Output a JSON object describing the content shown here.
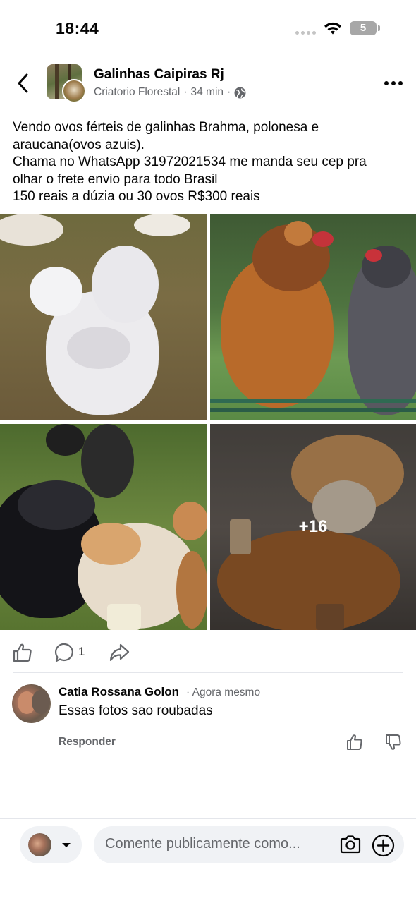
{
  "status_bar": {
    "time": "18:44",
    "battery": "5"
  },
  "header": {
    "group_name": "Galinhas Caipiras Rj",
    "author": "Criatorio Florestal",
    "separator": "·",
    "post_time": "34 min",
    "privacy_icon": "globe-icon"
  },
  "post": {
    "lines": [
      "Vendo ovos férteis de galinhas Brahma, polonesa e",
      "araucana(ovos azuis).",
      "Chama no WhatsApp 31972021534 me manda seu cep pra",
      "olhar o frete envio para todo Brasil",
      "150 reais a dúzia ou 30 ovos R$300 reais"
    ],
    "more_photos": "+16"
  },
  "actions": {
    "comment_count": "1"
  },
  "comment": {
    "author": "Catia Rossana Golon",
    "time": "· Agora mesmo",
    "text": "Essas fotos sao roubadas",
    "reply_label": "Responder"
  },
  "composer": {
    "placeholder": "Comente publicamente como..."
  },
  "colors": {
    "secondary_text": "#65676b",
    "input_background": "#f0f2f5"
  }
}
